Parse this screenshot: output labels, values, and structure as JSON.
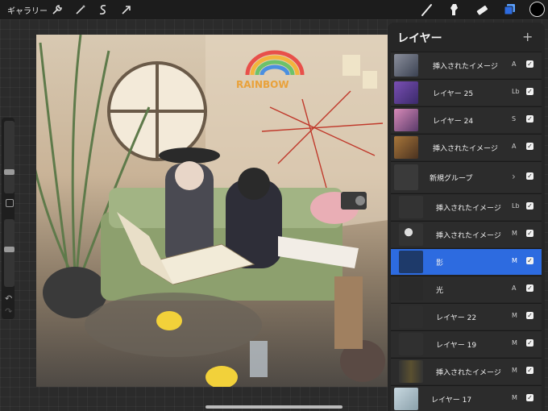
{
  "topbar": {
    "gallery": "ギャラリー",
    "tools": [
      "wrench-icon",
      "magic-wand-icon",
      "selection-icon",
      "move-arrow-icon"
    ],
    "right_tools": [
      "brush-icon",
      "smudge-icon",
      "eraser-icon",
      "layers-icon"
    ],
    "active_color": "#000000"
  },
  "layers_panel": {
    "title": "レイヤー",
    "add": "+",
    "items": [
      {
        "name": "挿入されたイメージ",
        "mode": "A",
        "visible": true
      },
      {
        "name": "レイヤー 25",
        "mode": "Lb",
        "visible": true
      },
      {
        "name": "レイヤー 24",
        "mode": "S",
        "visible": true
      },
      {
        "name": "挿入されたイメージ",
        "mode": "A",
        "visible": true
      },
      {
        "name": "新規グループ",
        "mode": "",
        "visible": true,
        "group": true
      },
      {
        "name": "挿入されたイメージ",
        "mode": "Lb",
        "visible": true
      },
      {
        "name": "挿入されたイメージ",
        "mode": "M",
        "visible": true
      },
      {
        "name": "影",
        "mode": "M",
        "visible": true,
        "selected": true
      },
      {
        "name": "光",
        "mode": "A",
        "visible": true
      },
      {
        "name": "レイヤー 22",
        "mode": "M",
        "visible": true
      },
      {
        "name": "レイヤー 19",
        "mode": "M",
        "visible": true
      },
      {
        "name": "挿入されたイメージ",
        "mode": "M",
        "visible": true
      },
      {
        "name": "レイヤー 17",
        "mode": "M",
        "visible": true
      }
    ]
  },
  "canvas_text": {
    "sign": "RAINBOW"
  },
  "colors": {
    "accent": "#2d6be0",
    "panel": "#262626",
    "topbar": "#1c1c1c"
  }
}
